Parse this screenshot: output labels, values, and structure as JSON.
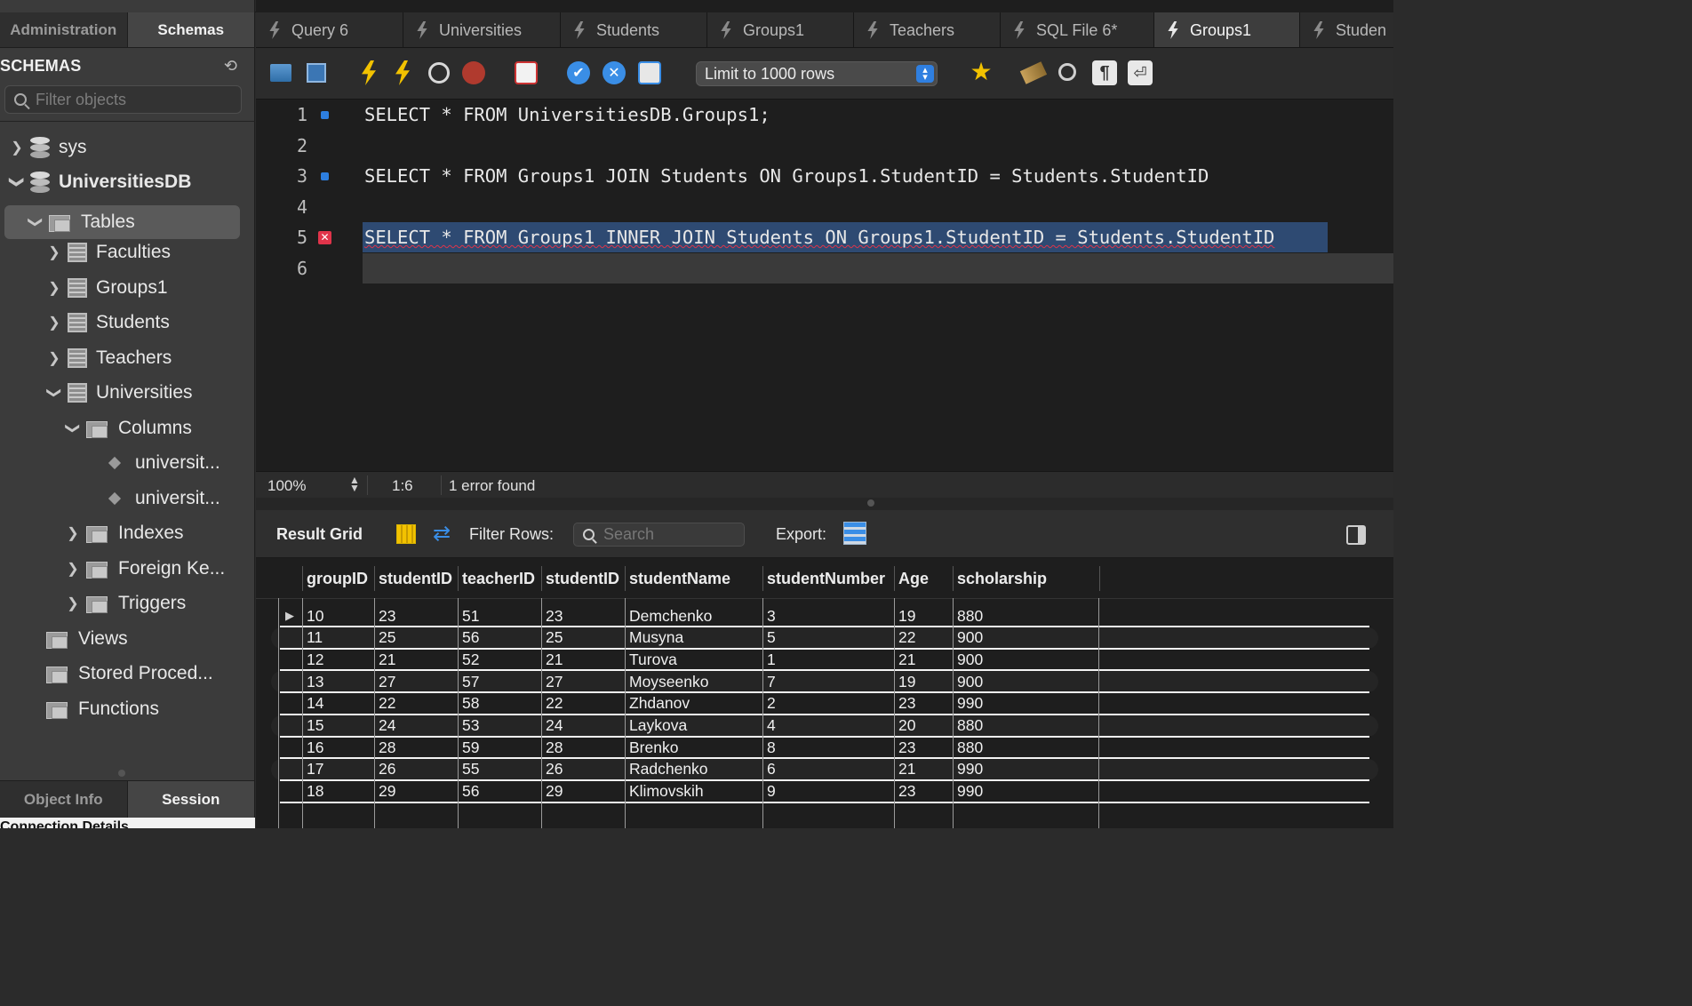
{
  "sidebar": {
    "tabs": [
      "Administration",
      "Schemas"
    ],
    "active_tab": "Schemas",
    "header": "SCHEMAS",
    "filter_placeholder": "Filter objects",
    "tree": {
      "sys": "sys",
      "universitiesdb": "UniversitiesDB",
      "tables": "Tables",
      "faculties": "Faculties",
      "groups1": "Groups1",
      "students": "Students",
      "teachers": "Teachers",
      "universities": "Universities",
      "columns": "Columns",
      "col1": "universit...",
      "col2": "universit...",
      "indexes": "Indexes",
      "foreign_keys": "Foreign Ke...",
      "triggers": "Triggers",
      "views": "Views",
      "stored_procedures": "Stored Proced...",
      "functions": "Functions"
    },
    "bottom_tabs": [
      "Object Info",
      "Session"
    ],
    "bottom_active": "Session",
    "connection_details": "Connection Details"
  },
  "query_tabs": [
    "Query 6",
    "Universities",
    "Students",
    "Groups1",
    "Teachers",
    "SQL File 6*",
    "Groups1",
    "Studen"
  ],
  "active_query_tab_index": 6,
  "toolbar": {
    "limit_label": "Limit to 1000 rows"
  },
  "editor": {
    "line_numbers": [
      "1",
      "2",
      "3",
      "4",
      "5",
      "6"
    ],
    "line1": "SELECT * FROM UniversitiesDB.Groups1;",
    "line3": "SELECT * FROM Groups1 JOIN Students ON Groups1.StudentID = Students.StudentID",
    "line5": "SELECT * FROM Groups1 INNER JOIN Students ON Groups1.StudentID = Students.StudentID"
  },
  "status": {
    "zoom": "100%",
    "cursor_pos": "1:6",
    "message": "1 error found"
  },
  "results": {
    "title": "Result Grid",
    "filter_label": "Filter Rows:",
    "search_placeholder": "Search",
    "export_label": "Export:",
    "columns": [
      "groupID",
      "studentID",
      "teacherID",
      "studentID",
      "studentName",
      "studentNumber",
      "Age",
      "scholarship"
    ],
    "rows": [
      [
        "10",
        "23",
        "51",
        "23",
        "Demchenko",
        "3",
        "19",
        "880"
      ],
      [
        "11",
        "25",
        "56",
        "25",
        "Musyna",
        "5",
        "22",
        "900"
      ],
      [
        "12",
        "21",
        "52",
        "21",
        "Turova",
        "1",
        "21",
        "900"
      ],
      [
        "13",
        "27",
        "57",
        "27",
        "Moyseenko",
        "7",
        "19",
        "900"
      ],
      [
        "14",
        "22",
        "58",
        "22",
        "Zhdanov",
        "2",
        "23",
        "990"
      ],
      [
        "15",
        "24",
        "53",
        "24",
        "Laykova",
        "4",
        "20",
        "880"
      ],
      [
        "16",
        "28",
        "59",
        "28",
        "Brenko",
        "8",
        "23",
        "880"
      ],
      [
        "17",
        "26",
        "55",
        "26",
        "Radchenko",
        "6",
        "21",
        "990"
      ],
      [
        "18",
        "29",
        "56",
        "29",
        "Klimovskih",
        "9",
        "23",
        "990"
      ]
    ]
  }
}
